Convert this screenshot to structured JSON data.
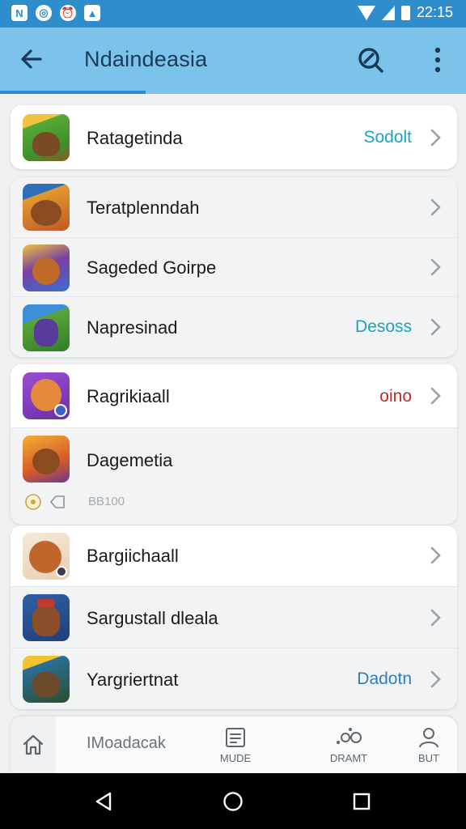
{
  "status_bar": {
    "time": "22:15",
    "left_icons": [
      "notification-n-icon",
      "location-icon",
      "alarm-icon",
      "app-icon"
    ]
  },
  "app_bar": {
    "title": "Ndaindeasia",
    "accent": "#7cc3ec",
    "indicator_color": "#2a8ed6"
  },
  "sections": [
    {
      "rows": [
        {
          "label": "Ratagetinda",
          "value": "Sodolt",
          "value_color": "cyan",
          "chevron": true,
          "thumb": "game-thumb-1"
        }
      ]
    },
    {
      "rows": [
        {
          "label": "Terаtplenndah",
          "value": "",
          "chevron": true,
          "thumb": "game-thumb-2"
        },
        {
          "label": "Sageded Goirpe",
          "value": "",
          "chevron": true,
          "thumb": "game-thumb-3"
        },
        {
          "label": "Napresinad",
          "value": "Desoss",
          "value_color": "cyan",
          "chevron": true,
          "thumb": "game-thumb-4"
        }
      ]
    },
    {
      "rows": [
        {
          "label": "Ragrikiaall",
          "value": "oino",
          "value_color": "red",
          "chevron": true,
          "thumb": "game-thumb-5"
        },
        {
          "label": "Dagemetia",
          "value": "",
          "chevron": false,
          "thumb": "game-thumb-6",
          "sub_text": "BB100"
        }
      ]
    },
    {
      "rows": [
        {
          "label": "Bargiichaall",
          "value": "",
          "chevron": true,
          "thumb": "game-thumb-7"
        },
        {
          "label": "Sargustall dleala",
          "value": "",
          "chevron": true,
          "thumb": "game-thumb-8"
        },
        {
          "label": "Yargriertnat",
          "value": "Dadotn",
          "value_color": "blue",
          "chevron": true,
          "thumb": "game-thumb-9"
        }
      ]
    }
  ],
  "bottom_nav": {
    "main_label": "IMoadacak",
    "items": [
      {
        "icon": "home-icon",
        "label": ""
      },
      {
        "icon": "document-icon",
        "label": "MUDE"
      },
      {
        "icon": "people-icon",
        "label": "DRAMT"
      },
      {
        "icon": "user-icon",
        "label": "BUT"
      }
    ]
  }
}
